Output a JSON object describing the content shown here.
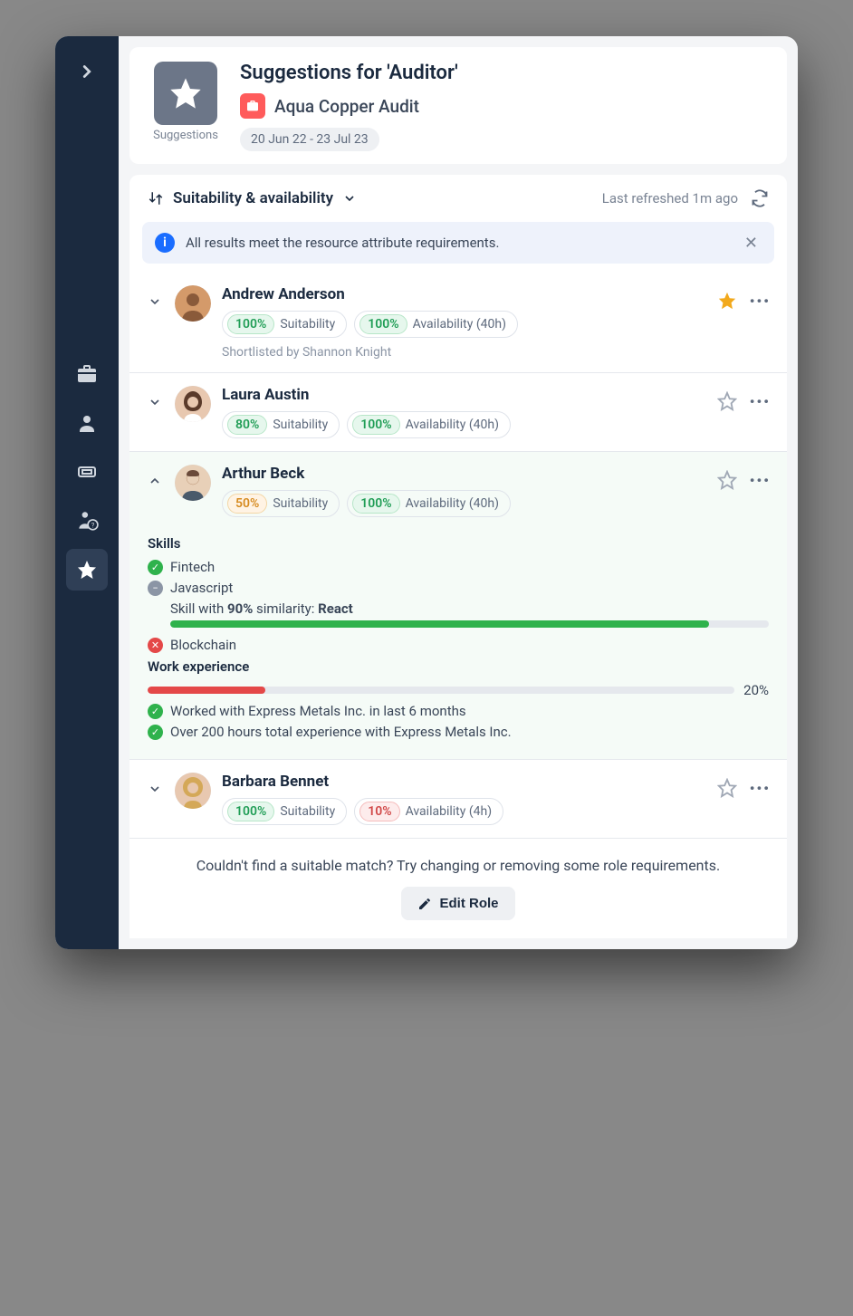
{
  "header": {
    "icon_label": "Suggestions",
    "title": "Suggestions for 'Auditor'",
    "project_name": "Aqua Copper Audit",
    "date_range": "20 Jun 22 - 23 Jul 23"
  },
  "filter": {
    "sort_label": "Suitability & availability",
    "refreshed_label": "Last refreshed 1m ago"
  },
  "banner": {
    "text": "All results meet the resource attribute requirements."
  },
  "people": [
    {
      "name": "Andrew Anderson",
      "suitability_pct": "100%",
      "suitability_label": "Suitability",
      "suitability_color": "green",
      "availability_pct": "100%",
      "availability_label": "Availability (40h)",
      "availability_color": "green",
      "starred": true,
      "expanded": false,
      "shortlisted_by": "Shortlisted by Shannon Knight"
    },
    {
      "name": "Laura Austin",
      "suitability_pct": "80%",
      "suitability_label": "Suitability",
      "suitability_color": "green",
      "availability_pct": "100%",
      "availability_label": "Availability (40h)",
      "availability_color": "green",
      "starred": false,
      "expanded": false
    },
    {
      "name": "Arthur Beck",
      "suitability_pct": "50%",
      "suitability_label": "Suitability",
      "suitability_color": "orange",
      "availability_pct": "100%",
      "availability_label": "Availability (40h)",
      "availability_color": "green",
      "starred": false,
      "expanded": true,
      "details": {
        "skills_label": "Skills",
        "skills": [
          {
            "status": "green",
            "label": "Fintech"
          },
          {
            "status": "gray",
            "label": "Javascript",
            "similarity_text": "Skill with 90% similarity: React",
            "similarity_pct": 90
          },
          {
            "status": "red",
            "label": "Blockchain"
          }
        ],
        "experience_label": "Work experience",
        "experience_pct": "20%",
        "experience_pct_num": 20,
        "experience_items": [
          "Worked with Express Metals Inc. in last 6 months",
          "Over 200 hours total experience with Express Metals Inc."
        ]
      }
    },
    {
      "name": "Barbara Bennet",
      "suitability_pct": "100%",
      "suitability_label": "Suitability",
      "suitability_color": "green",
      "availability_pct": "10%",
      "availability_label": "Availability (4h)",
      "availability_color": "red",
      "starred": false,
      "expanded": false
    }
  ],
  "footer": {
    "text": "Couldn't find a suitable match? Try changing or removing some role requirements.",
    "button": "Edit Role"
  }
}
